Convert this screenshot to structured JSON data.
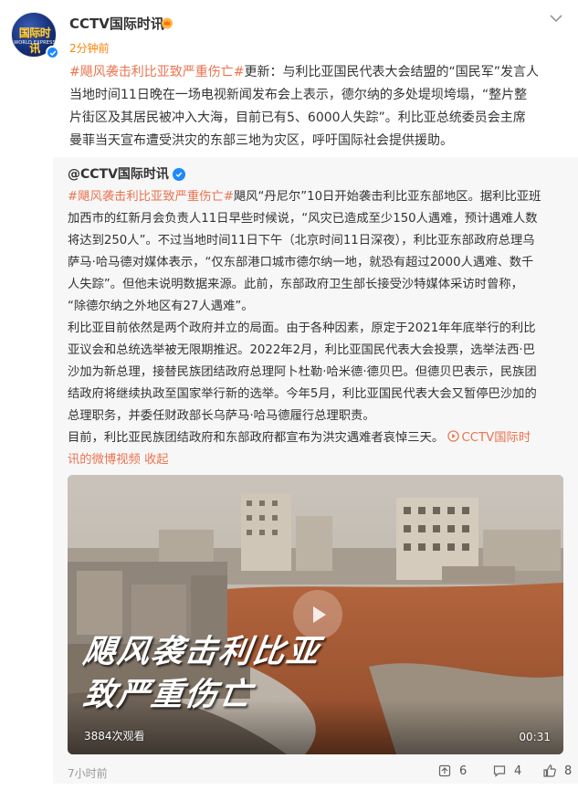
{
  "header": {
    "account_name": "CCTV国际时讯",
    "post_time": "2分钟前",
    "avatar_logo_text": "国际时讯",
    "avatar_logo_sub": "WORLD EXPRESS"
  },
  "main_post": {
    "topic": "#飓风袭击利比亚致严重伤亡#",
    "text_line_1": "更新：与利比亚国民代表大会结盟的“国民军”发言人",
    "text_line_2": "当地时间11日晚在一场电视新闻发布会上表示，德尔纳的多处堤坝垮塌，“整片整",
    "text_line_3": "片街区及其居民被冲入大海，目前已有5、6000人失踪”。利比亚总统委员会主席",
    "text_line_4": "曼菲当天宣布遭受洪灾的东部三地为灾区，呼吁国际社会提供援助。"
  },
  "repost": {
    "author": "@CCTV国际时讯",
    "topic": "#飓风袭击利比亚致严重伤亡#",
    "lines": [
      "飓风“丹尼尔”10日开始袭击利比亚东部地区。据利比亚班",
      "加西市的红新月会负责人11日早些时候说，“风灾已造成至少150人遇难，预计遇难人数",
      "将达到250人”。不过当地时间11日下午（北京时间11日深夜），利比亚东部政府总理乌",
      "萨马·哈马德对媒体表示，“仅东部港口城市德尔纳一地，就恐有超过2000人遇难、数千",
      "人失踪”。但他未说明数据来源。此前，东部政府卫生部长接受沙特媒体采访时曾称，",
      "“除德尔纳之外地区有27人遇难”。",
      "利比亚目前依然是两个政府并立的局面。由于各种因素，原定于2021年年底举行的利比",
      "亚议会和总统选举被无限期推迟。2022年2月，利比亚国民代表大会投票，选举法西·巴",
      "沙加为新总理，接替民族团结政府总理阿卜杜勒·哈米德·德贝巴。但德贝巴表示，民族团",
      "结政府将继续执政至国家举行新的选举。今年5月，利比亚国民代表大会又暂停巴沙加的",
      "总理职务，并委任财政部长乌萨马·哈马德履行总理职责。",
      "目前，利比亚民族团结政府和东部政府都宣布为洪灾遇难者哀悼三天。"
    ],
    "video_link_1": "CCTV国际时",
    "video_link_2": "讯的微博视频",
    "collapse_label": "收起",
    "video": {
      "caption_line_1": "飓风袭击利比亚",
      "caption_line_2": "致严重伤亡",
      "view_count": "3884次观看",
      "duration": "00:31"
    },
    "time": "7小时前",
    "reposts": "6",
    "comments": "4",
    "likes": "8"
  },
  "colors": {
    "topic": "#eb7350",
    "time_orange": "#ff8200",
    "verified_blue": "#1e88ff",
    "repost_bg": "#f7f7f7"
  },
  "icons": [
    "verified-icon",
    "vip-crown-icon",
    "more-chevron-icon",
    "play-icon",
    "repost-icon",
    "comment-icon",
    "like-icon"
  ]
}
